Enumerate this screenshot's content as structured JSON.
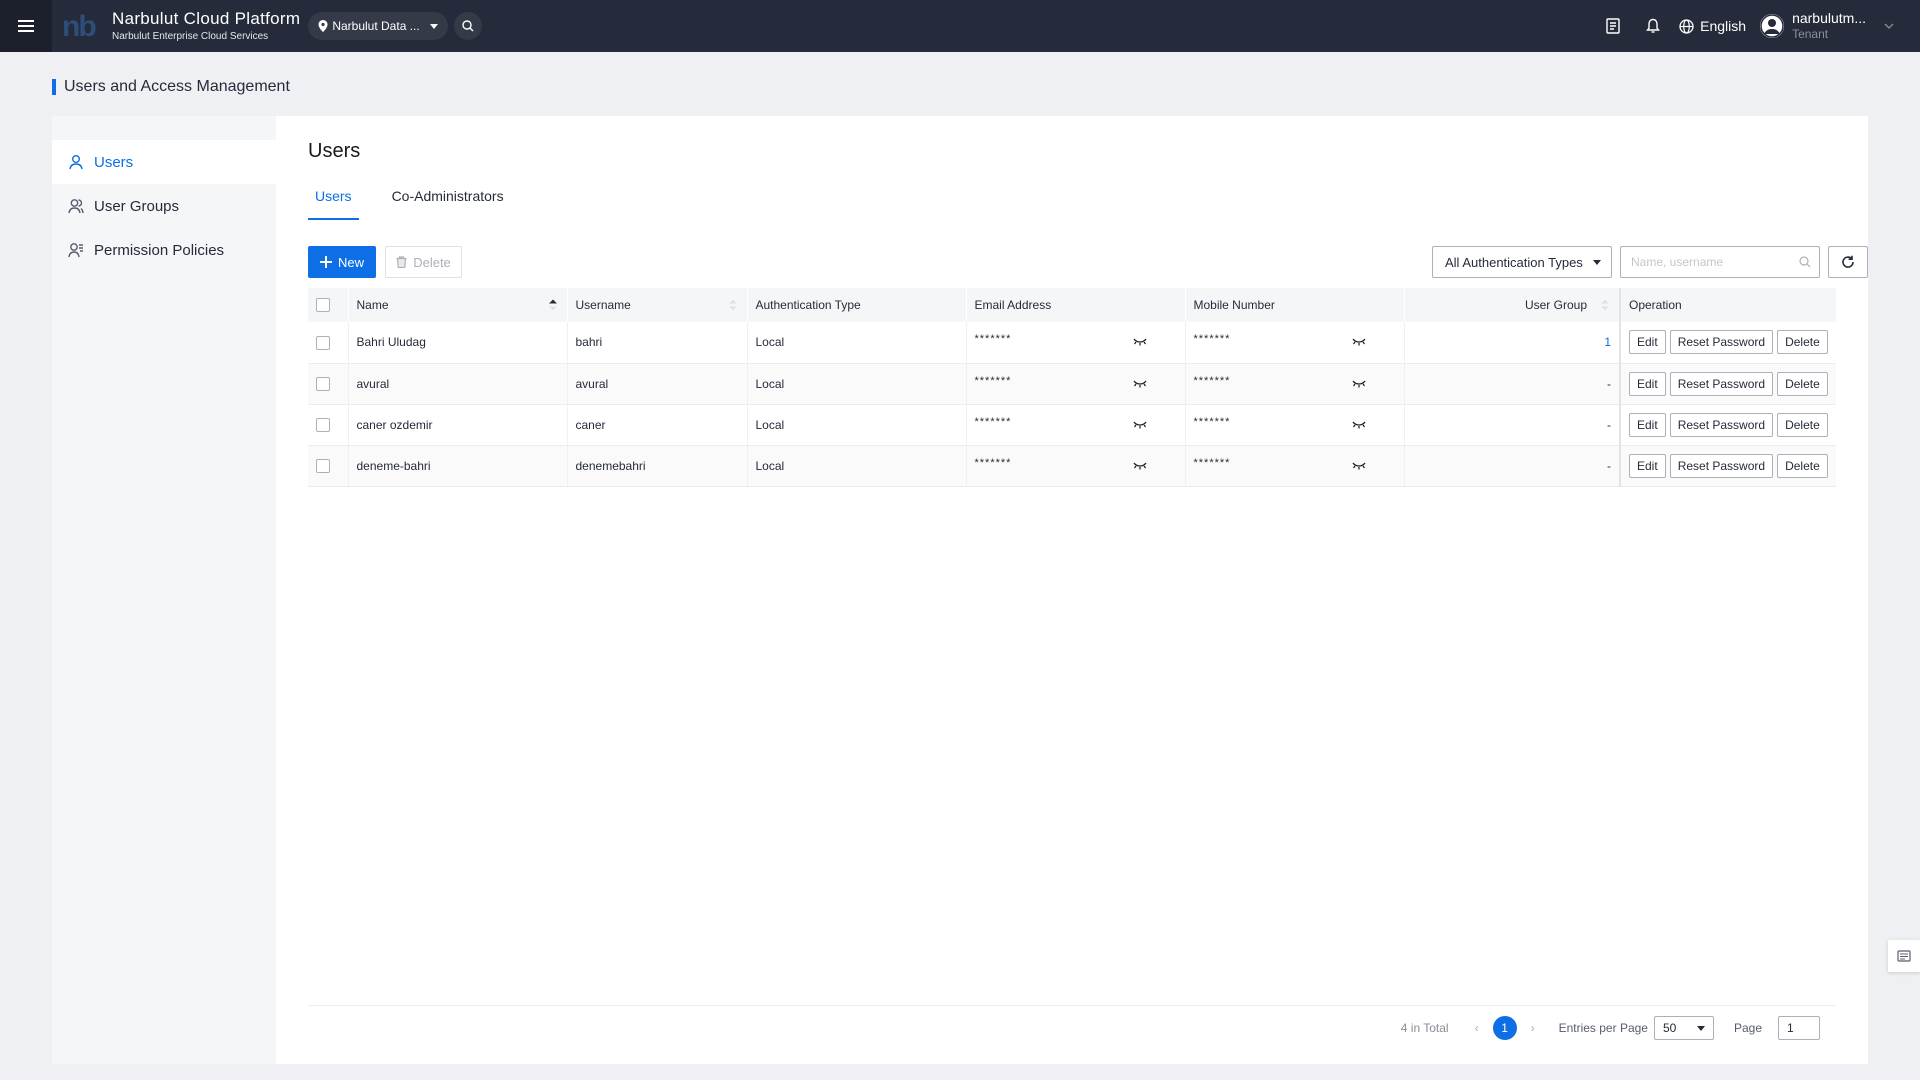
{
  "header": {
    "brand_name": "Narbulut Cloud Platform",
    "brand_sub": "Narbulut Enterprise Cloud Services",
    "region": "Narbulut Data ...",
    "language": "English",
    "user_name": "narbulutm...",
    "user_role": "Tenant"
  },
  "page_title": "Users and Access Management",
  "sidebar": {
    "items": [
      {
        "label": "Users",
        "icon": "user-icon",
        "active": true
      },
      {
        "label": "User Groups",
        "icon": "user-group-icon",
        "active": false
      },
      {
        "label": "Permission Policies",
        "icon": "permission-policy-icon",
        "active": false
      }
    ]
  },
  "main": {
    "heading": "Users",
    "tabs": [
      {
        "label": "Users",
        "active": true
      },
      {
        "label": "Co-Administrators",
        "active": false
      }
    ],
    "toolbar": {
      "new_label": "New",
      "delete_label": "Delete",
      "auth_filter": "All Authentication Types",
      "search_placeholder": "Name, username"
    },
    "table": {
      "columns": [
        "Name",
        "Username",
        "Authentication Type",
        "Email Address",
        "Mobile Number",
        "User Group",
        "Operation"
      ],
      "rows": [
        {
          "name": "Bahri Uludag",
          "username": "bahri",
          "auth": "Local",
          "email": "*******",
          "mobile": "*******",
          "group": "1"
        },
        {
          "name": "avural",
          "username": "avural",
          "auth": "Local",
          "email": "*******",
          "mobile": "*******",
          "group": "-"
        },
        {
          "name": "caner ozdemir",
          "username": "caner",
          "auth": "Local",
          "email": "*******",
          "mobile": "*******",
          "group": "-"
        },
        {
          "name": "deneme-bahri",
          "username": "denemebahri",
          "auth": "Local",
          "email": "*******",
          "mobile": "*******",
          "group": "-"
        }
      ],
      "ops": {
        "edit": "Edit",
        "reset": "Reset Password",
        "delete": "Delete"
      }
    },
    "pagination": {
      "total": "4 in Total",
      "current_page": "1",
      "entries_label": "Entries per Page",
      "entries_value": "50",
      "page_label": "Page",
      "page_value": "1"
    }
  },
  "colors": {
    "accent": "#0d6ee6",
    "topbar": "#252b3a"
  }
}
